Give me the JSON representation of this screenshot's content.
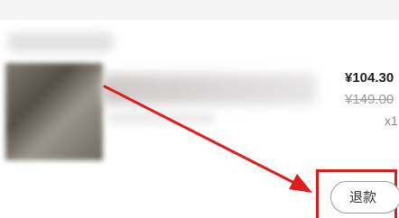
{
  "order_item": {
    "price": "¥104.30",
    "original_price": "¥149.00",
    "quantity": "x1"
  },
  "actions": {
    "refund_label": "退款"
  },
  "colors": {
    "annotation": "#e11c1c",
    "button_border": "#9b9b9b",
    "price_text": "#222222",
    "muted_text": "#999999"
  },
  "icons": {
    "annotation": "arrow-annotation-icon"
  }
}
